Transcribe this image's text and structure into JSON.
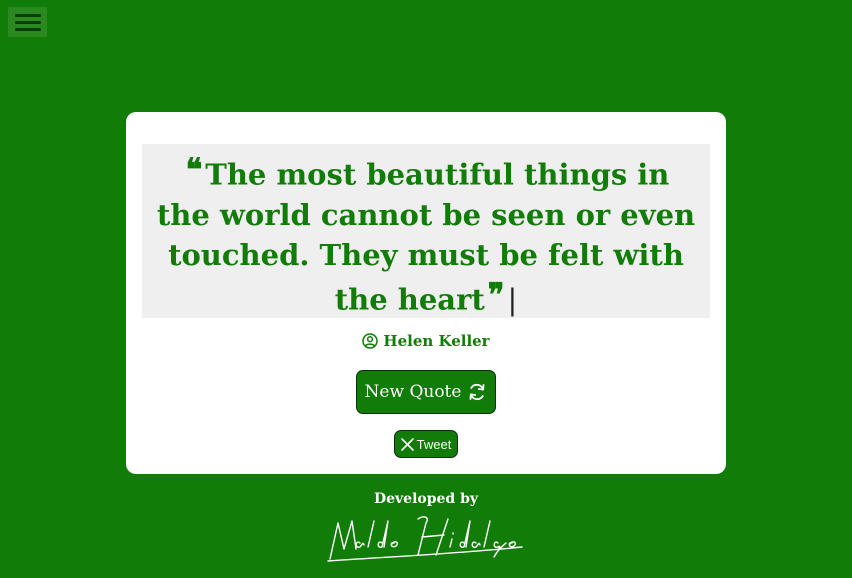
{
  "menu": {
    "icon": "hamburger-icon"
  },
  "quote": {
    "open_mark": "❝",
    "text": "The most beautiful things in the world cannot be seen or even touched. They must be felt with the heart",
    "close_mark": "❞",
    "cursor": "|"
  },
  "author": {
    "icon": "user-circle-icon",
    "name": "Helen Keller"
  },
  "buttons": {
    "new_quote_label": "New Quote",
    "new_quote_icon": "refresh-icon",
    "tweet_label": "Tweet",
    "tweet_icon": "x-logo-icon"
  },
  "footer": {
    "developed_by": "Developed by",
    "signature": "Waldo Hidalgo"
  },
  "colors": {
    "background": "#117c07",
    "card": "#ffffff",
    "quote_box": "#efefef",
    "accent": "#117c07"
  }
}
